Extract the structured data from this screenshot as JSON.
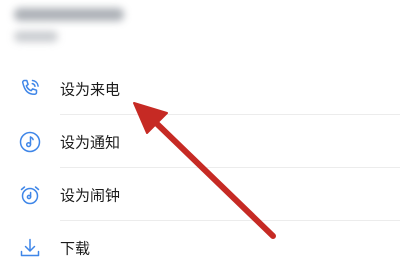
{
  "colors": {
    "icon_accent": "#3f86e8",
    "annotation_arrow": "#c62a24"
  },
  "menu": {
    "items": [
      {
        "label": "设为来电",
        "icon": "phone-icon"
      },
      {
        "label": "设为通知",
        "icon": "music-note-icon"
      },
      {
        "label": "设为闹钟",
        "icon": "alarm-clock-icon"
      },
      {
        "label": "下载",
        "icon": "download-icon"
      }
    ]
  }
}
